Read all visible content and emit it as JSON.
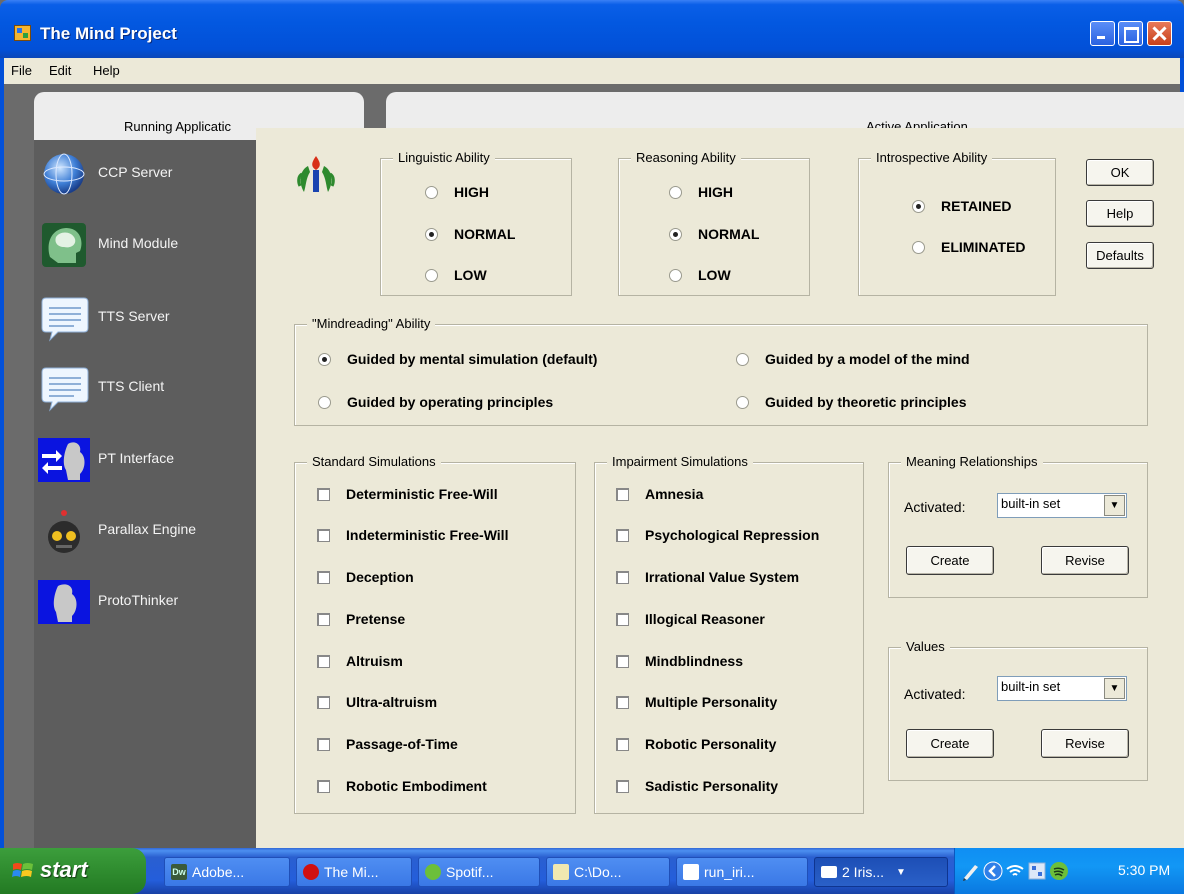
{
  "window": {
    "title": "The Mind Project"
  },
  "menu": {
    "items": [
      "File",
      "Edit",
      "Help"
    ]
  },
  "panels": {
    "running_label": "Running Applicatic",
    "active_label": "Active Application"
  },
  "apps": [
    {
      "label": "CCP Server",
      "icon": "globe-icon"
    },
    {
      "label": "Mind Module",
      "icon": "brain-head-icon"
    },
    {
      "label": "TTS Server",
      "icon": "speech-bubble-icon"
    },
    {
      "label": "TTS Client",
      "icon": "speech-bubble-icon"
    },
    {
      "label": "PT Interface",
      "icon": "thinker-arrows-icon"
    },
    {
      "label": "Parallax Engine",
      "icon": "robot-icon"
    },
    {
      "label": "ProtoThinker",
      "icon": "thinker-icon"
    }
  ],
  "dialog": {
    "logo": "torch-laurel-icon",
    "linguistic": {
      "title": "Linguistic Ability",
      "options": [
        "HIGH",
        "NORMAL",
        "LOW"
      ],
      "selected": "NORMAL"
    },
    "reasoning": {
      "title": "Reasoning Ability",
      "options": [
        "HIGH",
        "NORMAL",
        "LOW"
      ],
      "selected": "NORMAL"
    },
    "introspective": {
      "title": "Introspective Ability",
      "options": [
        "RETAINED",
        "ELIMINATED"
      ],
      "selected": "RETAINED"
    },
    "buttons": {
      "ok": "OK",
      "help": "Help",
      "defaults": "Defaults"
    },
    "mindreading": {
      "title": "\"Mindreading\" Ability",
      "options": [
        "Guided by mental simulation (default)",
        "Guided by a model of the mind",
        "Guided by operating principles",
        "Guided by theoretic principles"
      ],
      "selected": "Guided by mental simulation (default)"
    },
    "standard": {
      "title": "Standard Simulations",
      "items": [
        "Deterministic Free-Will",
        "Indeterministic Free-Will",
        "Deception",
        "Pretense",
        "Altruism",
        "Ultra-altruism",
        "Passage-of-Time",
        "Robotic Embodiment"
      ],
      "checked": []
    },
    "impairment": {
      "title": "Impairment Simulations",
      "items": [
        "Amnesia",
        "Psychological Repression",
        "Irrational Value System",
        "Illogical Reasoner",
        "Mindblindness",
        "Multiple Personality",
        "Robotic Personality",
        "Sadistic Personality"
      ],
      "checked": []
    },
    "meaning": {
      "title": "Meaning Relationships",
      "activated_label": "Activated:",
      "selected": "built-in set",
      "create": "Create",
      "revise": "Revise"
    },
    "values": {
      "title": "Values",
      "activated_label": "Activated:",
      "selected": "built-in set",
      "create": "Create",
      "revise": "Revise"
    }
  },
  "taskbar": {
    "start": "start",
    "tasks": [
      {
        "label": "Adobe...",
        "icon": "dreamweaver-icon",
        "color": "#3a5a3a"
      },
      {
        "label": "The Mi...",
        "icon": "opera-icon",
        "color": "#d01010"
      },
      {
        "label": "Spotif...",
        "icon": "spotify-icon",
        "color": "#6cbf3a"
      },
      {
        "label": "C:\\Do...",
        "icon": "notepad-icon",
        "color": "#f0e8b0"
      },
      {
        "label": "run_iri...",
        "icon": "document-icon",
        "color": "#ffffff"
      },
      {
        "label": "2 Iris...",
        "icon": "window-icon",
        "color": "#ffffff"
      }
    ],
    "clock": "5:30 PM"
  }
}
